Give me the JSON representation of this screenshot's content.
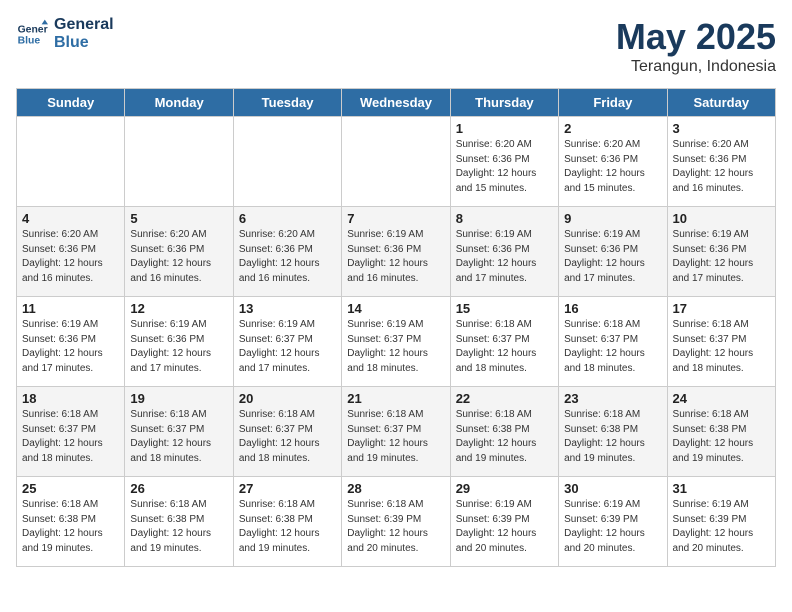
{
  "app": {
    "logo_line1": "General",
    "logo_line2": "Blue"
  },
  "title": "May 2025",
  "subtitle": "Terangun, Indonesia",
  "days_of_week": [
    "Sunday",
    "Monday",
    "Tuesday",
    "Wednesday",
    "Thursday",
    "Friday",
    "Saturday"
  ],
  "weeks": [
    [
      {
        "day": "",
        "info": ""
      },
      {
        "day": "",
        "info": ""
      },
      {
        "day": "",
        "info": ""
      },
      {
        "day": "",
        "info": ""
      },
      {
        "day": "1",
        "info": "Sunrise: 6:20 AM\nSunset: 6:36 PM\nDaylight: 12 hours\nand 15 minutes."
      },
      {
        "day": "2",
        "info": "Sunrise: 6:20 AM\nSunset: 6:36 PM\nDaylight: 12 hours\nand 15 minutes."
      },
      {
        "day": "3",
        "info": "Sunrise: 6:20 AM\nSunset: 6:36 PM\nDaylight: 12 hours\nand 16 minutes."
      }
    ],
    [
      {
        "day": "4",
        "info": "Sunrise: 6:20 AM\nSunset: 6:36 PM\nDaylight: 12 hours\nand 16 minutes."
      },
      {
        "day": "5",
        "info": "Sunrise: 6:20 AM\nSunset: 6:36 PM\nDaylight: 12 hours\nand 16 minutes."
      },
      {
        "day": "6",
        "info": "Sunrise: 6:20 AM\nSunset: 6:36 PM\nDaylight: 12 hours\nand 16 minutes."
      },
      {
        "day": "7",
        "info": "Sunrise: 6:19 AM\nSunset: 6:36 PM\nDaylight: 12 hours\nand 16 minutes."
      },
      {
        "day": "8",
        "info": "Sunrise: 6:19 AM\nSunset: 6:36 PM\nDaylight: 12 hours\nand 17 minutes."
      },
      {
        "day": "9",
        "info": "Sunrise: 6:19 AM\nSunset: 6:36 PM\nDaylight: 12 hours\nand 17 minutes."
      },
      {
        "day": "10",
        "info": "Sunrise: 6:19 AM\nSunset: 6:36 PM\nDaylight: 12 hours\nand 17 minutes."
      }
    ],
    [
      {
        "day": "11",
        "info": "Sunrise: 6:19 AM\nSunset: 6:36 PM\nDaylight: 12 hours\nand 17 minutes."
      },
      {
        "day": "12",
        "info": "Sunrise: 6:19 AM\nSunset: 6:36 PM\nDaylight: 12 hours\nand 17 minutes."
      },
      {
        "day": "13",
        "info": "Sunrise: 6:19 AM\nSunset: 6:37 PM\nDaylight: 12 hours\nand 17 minutes."
      },
      {
        "day": "14",
        "info": "Sunrise: 6:19 AM\nSunset: 6:37 PM\nDaylight: 12 hours\nand 18 minutes."
      },
      {
        "day": "15",
        "info": "Sunrise: 6:18 AM\nSunset: 6:37 PM\nDaylight: 12 hours\nand 18 minutes."
      },
      {
        "day": "16",
        "info": "Sunrise: 6:18 AM\nSunset: 6:37 PM\nDaylight: 12 hours\nand 18 minutes."
      },
      {
        "day": "17",
        "info": "Sunrise: 6:18 AM\nSunset: 6:37 PM\nDaylight: 12 hours\nand 18 minutes."
      }
    ],
    [
      {
        "day": "18",
        "info": "Sunrise: 6:18 AM\nSunset: 6:37 PM\nDaylight: 12 hours\nand 18 minutes."
      },
      {
        "day": "19",
        "info": "Sunrise: 6:18 AM\nSunset: 6:37 PM\nDaylight: 12 hours\nand 18 minutes."
      },
      {
        "day": "20",
        "info": "Sunrise: 6:18 AM\nSunset: 6:37 PM\nDaylight: 12 hours\nand 18 minutes."
      },
      {
        "day": "21",
        "info": "Sunrise: 6:18 AM\nSunset: 6:37 PM\nDaylight: 12 hours\nand 19 minutes."
      },
      {
        "day": "22",
        "info": "Sunrise: 6:18 AM\nSunset: 6:38 PM\nDaylight: 12 hours\nand 19 minutes."
      },
      {
        "day": "23",
        "info": "Sunrise: 6:18 AM\nSunset: 6:38 PM\nDaylight: 12 hours\nand 19 minutes."
      },
      {
        "day": "24",
        "info": "Sunrise: 6:18 AM\nSunset: 6:38 PM\nDaylight: 12 hours\nand 19 minutes."
      }
    ],
    [
      {
        "day": "25",
        "info": "Sunrise: 6:18 AM\nSunset: 6:38 PM\nDaylight: 12 hours\nand 19 minutes."
      },
      {
        "day": "26",
        "info": "Sunrise: 6:18 AM\nSunset: 6:38 PM\nDaylight: 12 hours\nand 19 minutes."
      },
      {
        "day": "27",
        "info": "Sunrise: 6:18 AM\nSunset: 6:38 PM\nDaylight: 12 hours\nand 19 minutes."
      },
      {
        "day": "28",
        "info": "Sunrise: 6:18 AM\nSunset: 6:39 PM\nDaylight: 12 hours\nand 20 minutes."
      },
      {
        "day": "29",
        "info": "Sunrise: 6:19 AM\nSunset: 6:39 PM\nDaylight: 12 hours\nand 20 minutes."
      },
      {
        "day": "30",
        "info": "Sunrise: 6:19 AM\nSunset: 6:39 PM\nDaylight: 12 hours\nand 20 minutes."
      },
      {
        "day": "31",
        "info": "Sunrise: 6:19 AM\nSunset: 6:39 PM\nDaylight: 12 hours\nand 20 minutes."
      }
    ]
  ]
}
